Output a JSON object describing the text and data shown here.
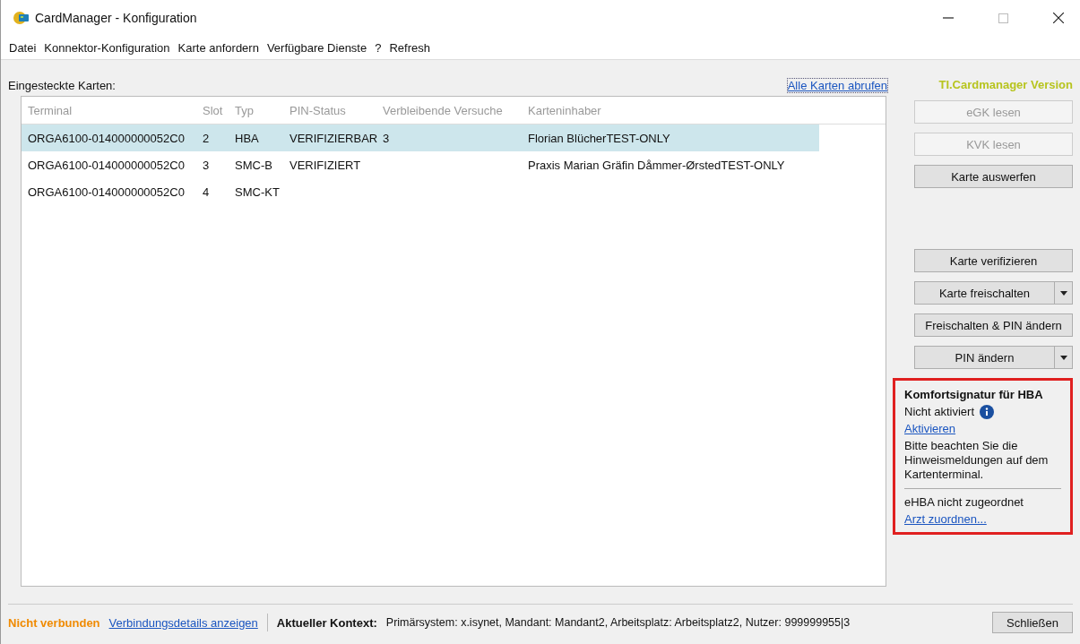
{
  "window": {
    "title": "CardManager - Konfiguration"
  },
  "menu": [
    "Datei",
    "Konnektor-Konfiguration",
    "Karte anfordern",
    "Verfügbare Dienste",
    "?",
    "Refresh"
  ],
  "cards_label": "Eingesteckte Karten:",
  "fetch_link": "Alle Karten abrufen",
  "version_label": "TI.Cardmanager Version",
  "table": {
    "columns": [
      "Terminal",
      "Slot",
      "Typ",
      "PIN-Status",
      "Verbleibende Versuche",
      "Karteninhaber"
    ],
    "rows": [
      {
        "cells": [
          "ORGA6100-014000000052C0",
          "2",
          "HBA",
          "VERIFIZIERBAR",
          "3",
          "Florian BlücherTEST-ONLY"
        ],
        "selected": true
      },
      {
        "cells": [
          "ORGA6100-014000000052C0",
          "3",
          "SMC-B",
          "VERIFIZIERT",
          "",
          "Praxis Marian Gräfin Dåmmer-ØrstedTEST-ONLY"
        ],
        "selected": false
      },
      {
        "cells": [
          "ORGA6100-014000000052C0",
          "4",
          "SMC-KT",
          "",
          "",
          ""
        ],
        "selected": false
      }
    ]
  },
  "buttons": [
    {
      "label": "eGK lesen",
      "kind": "plain",
      "disabled": true
    },
    {
      "label": "KVK lesen",
      "kind": "plain",
      "disabled": true
    },
    {
      "label": "Karte auswerfen",
      "kind": "plain",
      "disabled": false
    },
    {
      "kind": "spacer"
    },
    {
      "label": "Karte verifizieren",
      "kind": "plain",
      "disabled": false
    },
    {
      "label": "Karte freischalten",
      "kind": "split",
      "disabled": false
    },
    {
      "label": "Freischalten & PIN ändern",
      "kind": "plain",
      "disabled": false
    },
    {
      "label": "PIN ändern",
      "kind": "split",
      "disabled": false
    }
  ],
  "comfort": {
    "title": "Komfortsignatur für HBA",
    "status": "Nicht aktiviert",
    "activate_link": "Aktivieren",
    "note": "Bitte beachten Sie die Hinweismeldungen auf dem Kartenterminal.",
    "assignment": "eHBA nicht zugeordnet",
    "assign_link": "Arzt zuordnen..."
  },
  "status_bar": {
    "connection": "Nicht verbunden",
    "details_link": "Verbindungsdetails anzeigen",
    "context_label": "Aktueller Kontext:",
    "context": "Primärsystem: x.isynet, Mandant: Mandant2, Arbeitsplatz: Arbeitsplatz2, Nutzer: 999999955|3",
    "close_button": "Schließen"
  }
}
